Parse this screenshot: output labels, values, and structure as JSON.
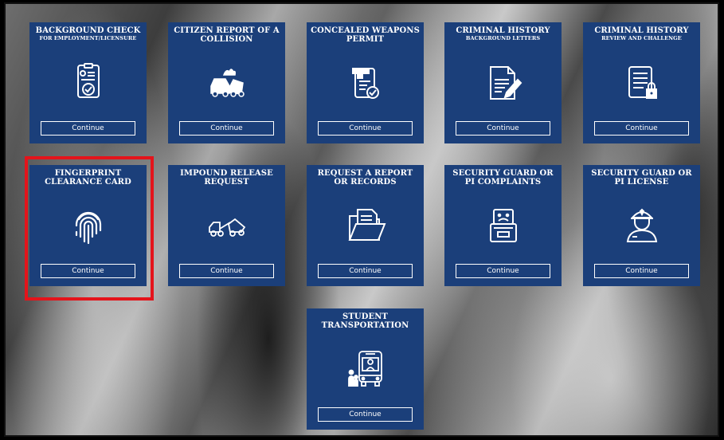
{
  "colors": {
    "card_bg": "#1b3f7a",
    "highlight": "#e4141b"
  },
  "cards": [
    {
      "title": "BACKGROUND CHECK",
      "subtitle": "FOR EMPLOYMENT/LICENSURE",
      "icon": "badge-check-icon",
      "button": "Continue"
    },
    {
      "title": "CITIZEN REPORT OF A COLLISION",
      "subtitle": "",
      "icon": "car-collision-icon",
      "button": "Continue"
    },
    {
      "title": "CONCEALED WEAPONS PERMIT",
      "subtitle": "",
      "icon": "weapon-permit-icon",
      "button": "Continue"
    },
    {
      "title": "CRIMINAL HISTORY",
      "subtitle": "BACKGROUND LETTERS",
      "icon": "document-pen-icon",
      "button": "Continue"
    },
    {
      "title": "CRIMINAL HISTORY",
      "subtitle": "REVIEW AND CHALLENGE",
      "icon": "document-lock-icon",
      "button": "Continue"
    },
    {
      "title": "FINGERPRINT CLEARANCE CARD",
      "subtitle": "",
      "icon": "fingerprint-icon",
      "button": "Continue"
    },
    {
      "title": "IMPOUND RELEASE REQUEST",
      "subtitle": "",
      "icon": "tow-truck-icon",
      "button": "Continue"
    },
    {
      "title": "REQUEST A REPORT OR RECORDS",
      "subtitle": "",
      "icon": "folder-document-icon",
      "button": "Continue"
    },
    {
      "title": "SECURITY GUARD OR PI COMPLAINTS",
      "subtitle": "",
      "icon": "complaint-box-icon",
      "button": "Continue"
    },
    {
      "title": "SECURITY GUARD OR PI LICENSE",
      "subtitle": "",
      "icon": "security-guard-icon",
      "button": "Continue"
    },
    {
      "title": "STUDENT TRANSPORTATION",
      "subtitle": "",
      "icon": "school-bus-icon",
      "button": "Continue"
    }
  ]
}
